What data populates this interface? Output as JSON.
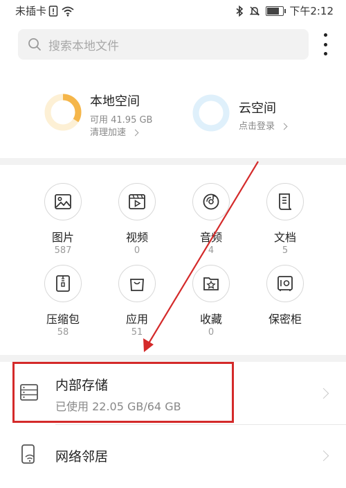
{
  "status_bar": {
    "carrier": "未插卡",
    "time": "下午2:12",
    "battery_level": 0.85,
    "icons": [
      "sim-warning-icon",
      "wifi-icon",
      "bluetooth-icon",
      "mute-icon",
      "battery-icon"
    ]
  },
  "search": {
    "placeholder": "搜索本地文件",
    "icon": "search-icon",
    "more_icon": "more-vertical-icon"
  },
  "local_space": {
    "title": "本地空间",
    "available": "可用 41.95 GB",
    "action": "清理加速",
    "used_fraction": 0.34,
    "ring_color": "#f5b64a",
    "ring_track": "#fdf0d5"
  },
  "cloud_space": {
    "title": "云空间",
    "action": "点击登录",
    "ring_color": "#dff0fb"
  },
  "categories": [
    {
      "label": "图片",
      "count": "587",
      "icon": "image-icon"
    },
    {
      "label": "视频",
      "count": "0",
      "icon": "video-icon"
    },
    {
      "label": "音频",
      "count": "4",
      "icon": "music-disc-icon"
    },
    {
      "label": "文档",
      "count": "5",
      "icon": "document-icon"
    },
    {
      "label": "压缩包",
      "count": "58",
      "icon": "zip-archive-icon"
    },
    {
      "label": "应用",
      "count": "51",
      "icon": "app-bag-icon"
    },
    {
      "label": "收藏",
      "count": "0",
      "icon": "star-folder-icon"
    },
    {
      "label": "保密柜",
      "count": "",
      "icon": "safe-icon"
    }
  ],
  "storage_list": [
    {
      "title": "内部存储",
      "subtitle": "已使用 22.05 GB/64 GB",
      "icon": "storage-drive-icon"
    },
    {
      "title": "网络邻居",
      "subtitle": "",
      "icon": "network-phone-icon"
    }
  ],
  "annotation": {
    "highlight_color": "#d42a2a",
    "arrow_color": "#d42a2a"
  }
}
